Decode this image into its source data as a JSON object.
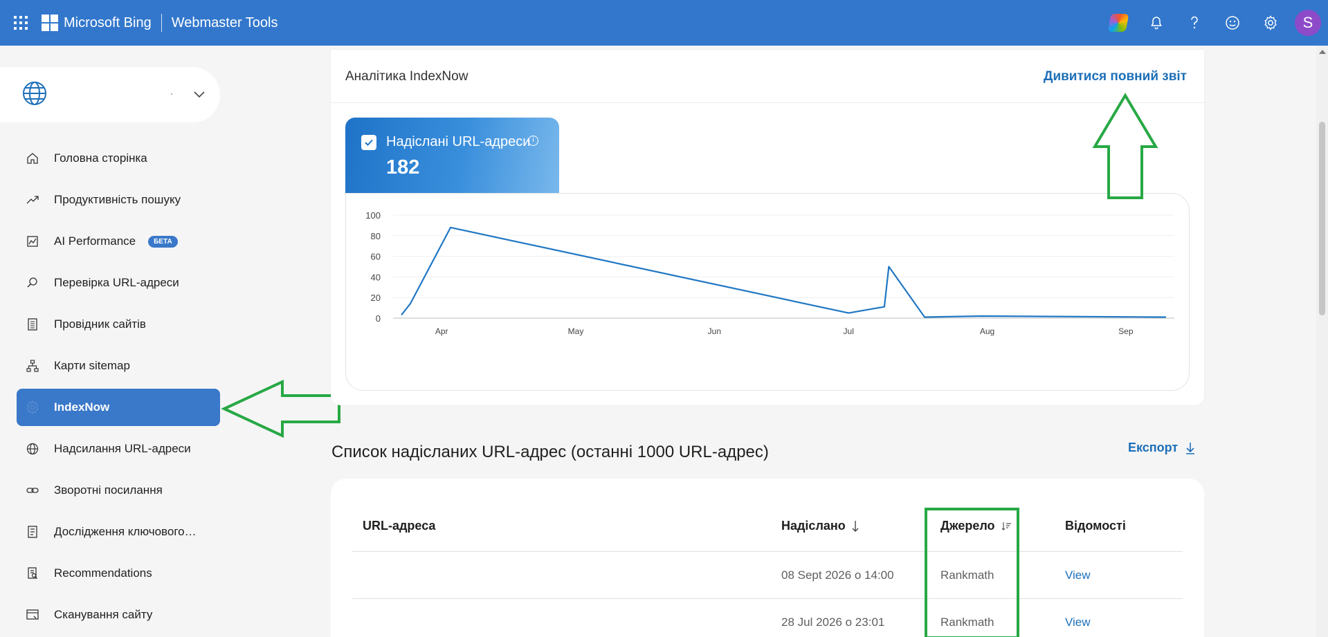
{
  "header": {
    "brand": "Microsoft Bing",
    "product": "Webmaster Tools",
    "avatar_letter": "S",
    "icons": [
      "copilot-icon",
      "bell-icon",
      "help-icon",
      "feedback-icon",
      "settings-icon"
    ]
  },
  "sidebar": {
    "site_picker": {
      "value": ""
    },
    "items": [
      {
        "label": "Головна сторінка",
        "icon": "home-icon"
      },
      {
        "label": "Продуктивність пошуку",
        "icon": "trend-icon"
      },
      {
        "label": "AI Performance",
        "icon": "chart-icon",
        "badge": "БЕТА"
      },
      {
        "label": "Перевірка URL-адреси",
        "icon": "search-icon"
      },
      {
        "label": "Провідник сайтів",
        "icon": "explorer-icon"
      },
      {
        "label": "Карти sitemap",
        "icon": "sitemap-icon"
      },
      {
        "label": "IndexNow",
        "icon": "indexnow-icon",
        "active": true
      },
      {
        "label": "Надсилання URL-адреси",
        "icon": "globe-icon"
      },
      {
        "label": "Зворотні посилання",
        "icon": "link-icon"
      },
      {
        "label": "Дослідження ключового…",
        "icon": "keyword-icon"
      },
      {
        "label": "Recommendations",
        "icon": "recommendations-icon"
      },
      {
        "label": "Сканування сайту",
        "icon": "scan-icon"
      }
    ]
  },
  "analytics": {
    "title": "Аналітика IndexNow",
    "full_report_link": "Дивитися повний звіт",
    "metric_label": "Надіслані URL-адреси",
    "metric_value": "182",
    "info_symbol": "i"
  },
  "chart_data": {
    "type": "line",
    "title": "",
    "xlabel": "",
    "ylabel": "",
    "ylim": [
      0,
      100
    ],
    "yticks": [
      "0",
      "20",
      "40",
      "60",
      "80",
      "100"
    ],
    "xtick_labels": [
      "Apr",
      "May",
      "Jun",
      "Jul",
      "Aug",
      "Sep"
    ],
    "grid": true,
    "color": "#1f77c4",
    "series": [
      {
        "x": [
          "Mar 23",
          "Mar 25",
          "Apr 3",
          "Jul 1",
          "Jul 5",
          "Jul 9",
          "Jul 10",
          "Jul 18",
          "Jul 31",
          "Sep 10"
        ],
        "values": [
          3,
          14,
          88,
          5,
          8,
          11,
          50,
          1,
          2,
          1
        ]
      }
    ]
  },
  "list": {
    "title": "Список надісланих URL-адрес (останні 1000 URL-адрес)",
    "export_label": "Експорт",
    "columns": [
      "URL-адреса",
      "Надіслано",
      "Джерело",
      "Відомості"
    ],
    "rows": [
      {
        "url": "",
        "submitted": "08 Sept 2026 о 14:00",
        "source": "Rankmath",
        "details": "View"
      },
      {
        "url": "",
        "submitted": "28 Jul 2026 о 23:01",
        "source": "Rankmath",
        "details": "View"
      }
    ]
  },
  "annotations": {
    "arrow_color": "#27a845"
  }
}
